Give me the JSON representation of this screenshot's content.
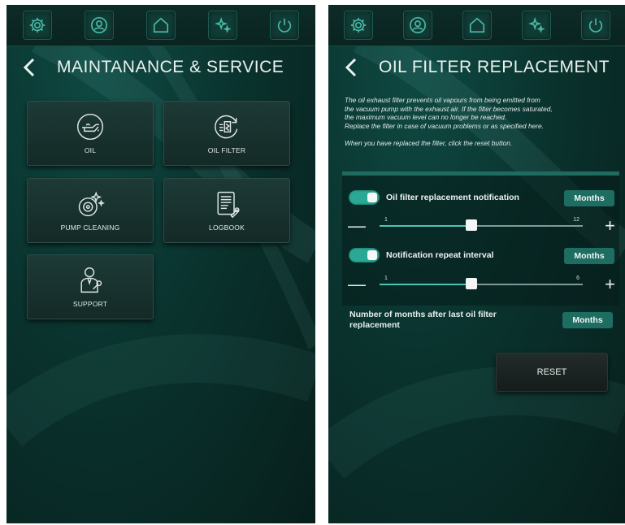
{
  "left": {
    "title": "MAINTANANCE & SERVICE",
    "tiles": [
      {
        "label": "OIL",
        "icon": "oil-can-icon"
      },
      {
        "label": "OIL FILTER",
        "icon": "oil-filter-icon"
      },
      {
        "label": "PUMP CLEANING",
        "icon": "pump-cleaning-icon"
      },
      {
        "label": "LOGBOOK",
        "icon": "logbook-icon"
      },
      {
        "label": "SUPPORT",
        "icon": "support-icon"
      }
    ]
  },
  "right": {
    "title": "OIL FILTER REPLACEMENT",
    "description": [
      "The oil exhaust filter prevents oil vapours from being emitted from",
      "the vacuum pump with the exhaust air. If the filter becomes saturated,",
      "the maximum vacuum level can no longer be reached.",
      "Replace the filter in case of vacuum problems or as specified here."
    ],
    "description_reset": "When you have replaced the filter, click the reset button.",
    "notification": {
      "label": "Oil filter replacement notification",
      "unit": "Months",
      "enabled": true,
      "slider": {
        "min": 1,
        "max": 12,
        "min_label": "1",
        "max_label": "12",
        "value_fraction": 0.45
      }
    },
    "repeat": {
      "label": "Notification repeat interval",
      "unit": "Months",
      "enabled": true,
      "slider": {
        "min": 1,
        "max": 6,
        "min_label": "1",
        "max_label": "6",
        "value_fraction": 0.45
      }
    },
    "months_count": {
      "label": "Number of months after last oil filter replacement",
      "unit": "Months"
    },
    "reset_label": "RESET"
  },
  "topbar_icons": [
    "gear-icon",
    "user-icon",
    "home-icon",
    "sparkle-icon",
    "power-icon"
  ],
  "colors": {
    "accent": "#2aa894",
    "background": "#0a332e",
    "button": "#1e6d62"
  }
}
